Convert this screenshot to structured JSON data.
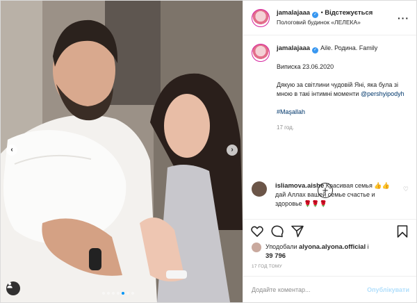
{
  "post": {
    "username": "jamalajaaa",
    "follow_label": "Відстежується",
    "location": "Пологовий будинок «ЛЕЛЕКА»",
    "more_icon": "more-horizontal-icon"
  },
  "caption": {
    "username": "jamalajaaa",
    "line1": "Aile. Родина. Family",
    "line2": "Виписка 23.06.2020",
    "line3": "Дякую за світлини чудовій Яні, яка була зі мною в такі інтимні моменти",
    "mention": "@pershyipodyh",
    "hashtag": "#Maşallah",
    "time": "17 год."
  },
  "comment": {
    "username": "isliamova.aishe",
    "text": "Красивая семья 👍👍дай Аллах вашей семье счастье и здоровье 🌹🌹🌹"
  },
  "likes": {
    "prefix": "Уподобали",
    "user": "alyona.alyona.official",
    "suffix": "і",
    "count": "39 796"
  },
  "timestamp": "17 ГОД ТОМУ",
  "add_comment": {
    "placeholder": "Додайте коментар...",
    "publish": "Опублікувати"
  },
  "carousel": {
    "count": 7,
    "active_index": 4
  },
  "colors": {
    "accent": "#0095f6",
    "link": "#00376b",
    "verified": "#3897f0"
  }
}
